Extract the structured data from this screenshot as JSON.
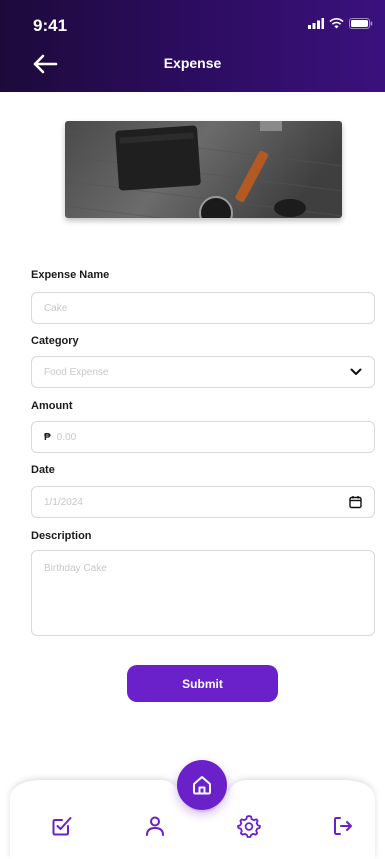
{
  "status_bar": {
    "time": "9:41"
  },
  "header": {
    "title": "Expense"
  },
  "form": {
    "expense_name": {
      "label": "Expense Name",
      "placeholder": "Cake"
    },
    "category": {
      "label": "Category",
      "placeholder": "Food Expense"
    },
    "amount": {
      "label": "Amount",
      "currency": "₱",
      "placeholder": "0.00"
    },
    "date": {
      "label": "Date",
      "placeholder": "1/1/2024"
    },
    "description": {
      "label": "Description",
      "placeholder": "Birthday Cake"
    },
    "submit_label": "Submit"
  },
  "bottom_nav": {
    "items": [
      {
        "icon": "checkbox-edit-icon"
      },
      {
        "icon": "user-icon"
      },
      {
        "icon": "home-icon"
      },
      {
        "icon": "gear-icon"
      },
      {
        "icon": "logout-icon"
      }
    ]
  },
  "colors": {
    "accent": "#6a21c9",
    "header_dark": "#1d0a3a"
  }
}
